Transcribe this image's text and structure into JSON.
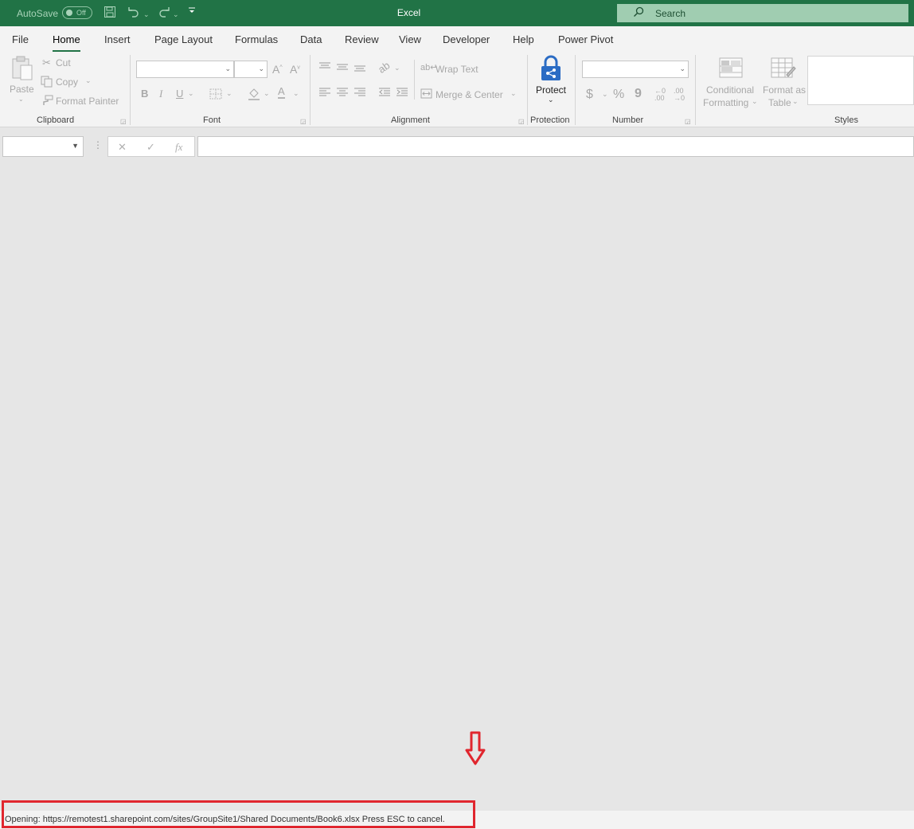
{
  "titlebar": {
    "autosave_label": "AutoSave",
    "autosave_state": "Off",
    "app_title": "Excel",
    "search_placeholder": "Search",
    "accent_color": "#217346"
  },
  "tabs": [
    "File",
    "Home",
    "Insert",
    "Page Layout",
    "Formulas",
    "Data",
    "Review",
    "View",
    "Developer",
    "Help",
    "Power Pivot"
  ],
  "active_tab": "Home",
  "ribbon": {
    "clipboard": {
      "paste": "Paste",
      "cut": "Cut",
      "copy": "Copy",
      "format_painter": "Format Painter",
      "label": "Clipboard"
    },
    "font": {
      "bold": "B",
      "italic": "I",
      "underline": "U",
      "font_color_glyph": "A",
      "label": "Font"
    },
    "alignment": {
      "wrap_text": "Wrap Text",
      "merge_center": "Merge & Center",
      "label": "Alignment"
    },
    "protection": {
      "protect": "Protect",
      "label": "Protection"
    },
    "number": {
      "currency": "$",
      "percent": "%",
      "comma": "9",
      "inc_decimal": "←.0\n.00",
      "label": "Number"
    },
    "styles": {
      "conditional_formatting_1": "Conditional",
      "conditional_formatting_2": "Formatting",
      "format_table_1": "Format as",
      "format_table_2": "Table",
      "label": "Styles"
    }
  },
  "formula_bar": {
    "fx": "fx"
  },
  "status": {
    "text": "Opening: https://remotest1.sharepoint.com/sites/GroupSite1/Shared Documents/Book6.xlsx Press ESC to cancel.",
    "highlight_color": "#e0262e"
  }
}
